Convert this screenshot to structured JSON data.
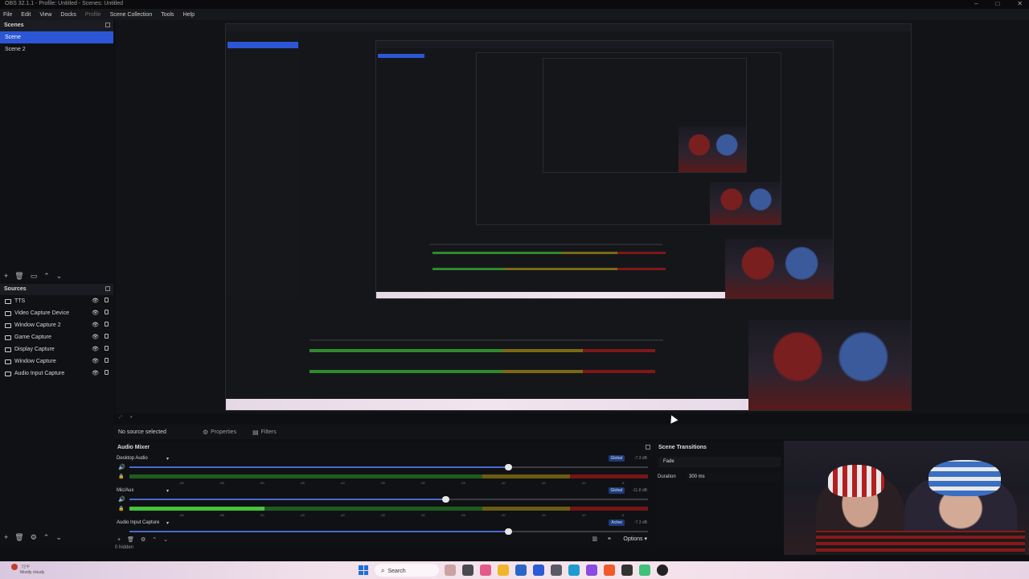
{
  "window": {
    "title": "OBS 32.1.1 - Profile: Untitled - Scenes: Untitled"
  },
  "menu": {
    "items": [
      "File",
      "Edit",
      "View",
      "Docks",
      "Profile",
      "Scene Collection",
      "Tools",
      "Help"
    ]
  },
  "scenes": {
    "title": "Scenes",
    "items": [
      "Scene",
      "Scene 2"
    ]
  },
  "sources": {
    "title": "Sources",
    "items": [
      "TTS",
      "Video Capture Device",
      "Window Capture 2",
      "Game Capture",
      "Display Capture",
      "Window Capture",
      "Audio Input Capture"
    ]
  },
  "source_toolbar": {
    "no_source": "No source selected",
    "properties": "Properties",
    "filters": "Filters"
  },
  "audio_mixer": {
    "title": "Audio Mixer",
    "channels": [
      {
        "name": "Desktop Audio",
        "badge": "Global",
        "db": "-7.3 dB",
        "volume": 0.73,
        "level": 0.0
      },
      {
        "name": "Mic/Aux",
        "badge": "Global",
        "db": "-11.8 dB",
        "volume": 0.61,
        "level": 0.26
      },
      {
        "name": "Audio Input Capture",
        "badge": "Active",
        "db": "-7.3 dB",
        "volume": 0.73,
        "level": 0.0
      }
    ],
    "ticks": [
      "-60",
      "-55",
      "-50",
      "-45",
      "-40",
      "-35",
      "-30",
      "-25",
      "-20",
      "-15",
      "-10",
      "-5",
      "0"
    ],
    "hidden_label": "0 hidden",
    "options_label": "Options"
  },
  "transitions": {
    "title": "Scene Transitions",
    "selected": "Fade",
    "duration_label": "Duration",
    "duration_value": "300 ms"
  },
  "taskbar": {
    "weather_temp": "72°F",
    "weather_desc": "Mostly cloudy",
    "search_label": "Search"
  },
  "colors": {
    "accent": "#2c56d6",
    "meter_green": "#43c53a",
    "meter_yellow": "#6a5c12",
    "meter_red": "#741616"
  }
}
